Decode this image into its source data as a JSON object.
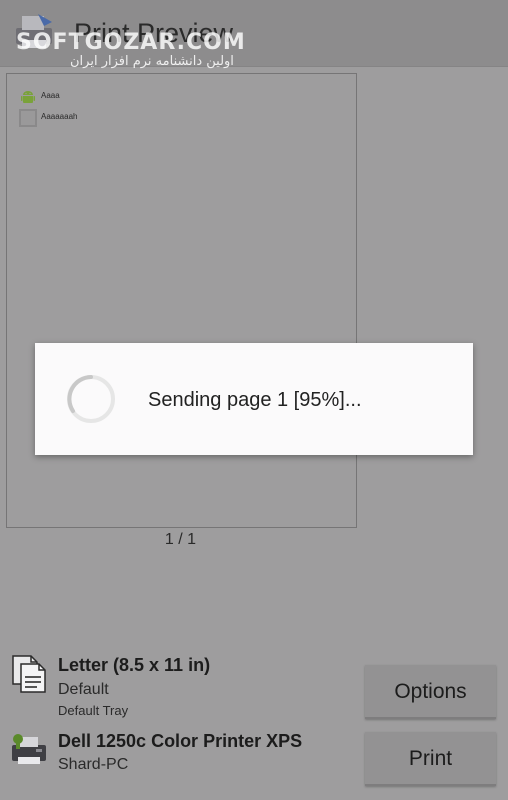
{
  "action_bar": {
    "title": "Print Preview",
    "watermark": "SOFTGOZAR.COM",
    "watermark_sub": "اولین دانشنامه نرم افزار ایران"
  },
  "preview": {
    "items": [
      {
        "label": "Aaaa",
        "icon": "android-icon"
      },
      {
        "label": "Aaaaaaah",
        "icon": "image-thumbnail-icon"
      }
    ],
    "page_counter": "1 / 1"
  },
  "dialog": {
    "message": "Sending page 1 [95%]...",
    "progress": 0.95
  },
  "paper": {
    "size": "Letter (8.5 x 11 in)",
    "type": "Default",
    "tray": "Default Tray"
  },
  "printer": {
    "name": "Dell 1250c Color Printer XPS",
    "host": "Shard-PC"
  },
  "buttons": {
    "options": "Options",
    "print": "Print"
  },
  "colors": {
    "overlay_bg": "#9e9d9e",
    "action_bar": "#8d8c8d",
    "dialog_bg": "#fbfafb",
    "button_bg": "#939293"
  }
}
